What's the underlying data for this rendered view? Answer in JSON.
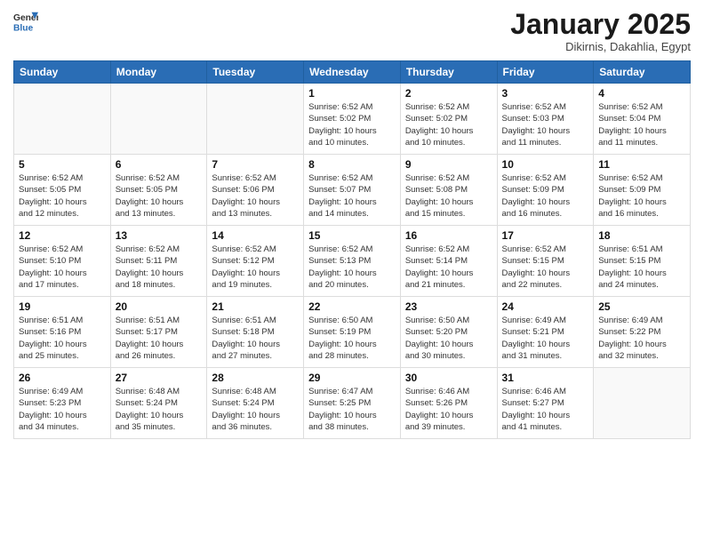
{
  "header": {
    "logo_general": "General",
    "logo_blue": "Blue",
    "title": "January 2025",
    "subtitle": "Dikirnis, Dakahlia, Egypt"
  },
  "days_of_week": [
    "Sunday",
    "Monday",
    "Tuesday",
    "Wednesday",
    "Thursday",
    "Friday",
    "Saturday"
  ],
  "weeks": [
    [
      {
        "day": "",
        "info": ""
      },
      {
        "day": "",
        "info": ""
      },
      {
        "day": "",
        "info": ""
      },
      {
        "day": "1",
        "info": "Sunrise: 6:52 AM\nSunset: 5:02 PM\nDaylight: 10 hours\nand 10 minutes."
      },
      {
        "day": "2",
        "info": "Sunrise: 6:52 AM\nSunset: 5:02 PM\nDaylight: 10 hours\nand 10 minutes."
      },
      {
        "day": "3",
        "info": "Sunrise: 6:52 AM\nSunset: 5:03 PM\nDaylight: 10 hours\nand 11 minutes."
      },
      {
        "day": "4",
        "info": "Sunrise: 6:52 AM\nSunset: 5:04 PM\nDaylight: 10 hours\nand 11 minutes."
      }
    ],
    [
      {
        "day": "5",
        "info": "Sunrise: 6:52 AM\nSunset: 5:05 PM\nDaylight: 10 hours\nand 12 minutes."
      },
      {
        "day": "6",
        "info": "Sunrise: 6:52 AM\nSunset: 5:05 PM\nDaylight: 10 hours\nand 13 minutes."
      },
      {
        "day": "7",
        "info": "Sunrise: 6:52 AM\nSunset: 5:06 PM\nDaylight: 10 hours\nand 13 minutes."
      },
      {
        "day": "8",
        "info": "Sunrise: 6:52 AM\nSunset: 5:07 PM\nDaylight: 10 hours\nand 14 minutes."
      },
      {
        "day": "9",
        "info": "Sunrise: 6:52 AM\nSunset: 5:08 PM\nDaylight: 10 hours\nand 15 minutes."
      },
      {
        "day": "10",
        "info": "Sunrise: 6:52 AM\nSunset: 5:09 PM\nDaylight: 10 hours\nand 16 minutes."
      },
      {
        "day": "11",
        "info": "Sunrise: 6:52 AM\nSunset: 5:09 PM\nDaylight: 10 hours\nand 16 minutes."
      }
    ],
    [
      {
        "day": "12",
        "info": "Sunrise: 6:52 AM\nSunset: 5:10 PM\nDaylight: 10 hours\nand 17 minutes."
      },
      {
        "day": "13",
        "info": "Sunrise: 6:52 AM\nSunset: 5:11 PM\nDaylight: 10 hours\nand 18 minutes."
      },
      {
        "day": "14",
        "info": "Sunrise: 6:52 AM\nSunset: 5:12 PM\nDaylight: 10 hours\nand 19 minutes."
      },
      {
        "day": "15",
        "info": "Sunrise: 6:52 AM\nSunset: 5:13 PM\nDaylight: 10 hours\nand 20 minutes."
      },
      {
        "day": "16",
        "info": "Sunrise: 6:52 AM\nSunset: 5:14 PM\nDaylight: 10 hours\nand 21 minutes."
      },
      {
        "day": "17",
        "info": "Sunrise: 6:52 AM\nSunset: 5:15 PM\nDaylight: 10 hours\nand 22 minutes."
      },
      {
        "day": "18",
        "info": "Sunrise: 6:51 AM\nSunset: 5:15 PM\nDaylight: 10 hours\nand 24 minutes."
      }
    ],
    [
      {
        "day": "19",
        "info": "Sunrise: 6:51 AM\nSunset: 5:16 PM\nDaylight: 10 hours\nand 25 minutes."
      },
      {
        "day": "20",
        "info": "Sunrise: 6:51 AM\nSunset: 5:17 PM\nDaylight: 10 hours\nand 26 minutes."
      },
      {
        "day": "21",
        "info": "Sunrise: 6:51 AM\nSunset: 5:18 PM\nDaylight: 10 hours\nand 27 minutes."
      },
      {
        "day": "22",
        "info": "Sunrise: 6:50 AM\nSunset: 5:19 PM\nDaylight: 10 hours\nand 28 minutes."
      },
      {
        "day": "23",
        "info": "Sunrise: 6:50 AM\nSunset: 5:20 PM\nDaylight: 10 hours\nand 30 minutes."
      },
      {
        "day": "24",
        "info": "Sunrise: 6:49 AM\nSunset: 5:21 PM\nDaylight: 10 hours\nand 31 minutes."
      },
      {
        "day": "25",
        "info": "Sunrise: 6:49 AM\nSunset: 5:22 PM\nDaylight: 10 hours\nand 32 minutes."
      }
    ],
    [
      {
        "day": "26",
        "info": "Sunrise: 6:49 AM\nSunset: 5:23 PM\nDaylight: 10 hours\nand 34 minutes."
      },
      {
        "day": "27",
        "info": "Sunrise: 6:48 AM\nSunset: 5:24 PM\nDaylight: 10 hours\nand 35 minutes."
      },
      {
        "day": "28",
        "info": "Sunrise: 6:48 AM\nSunset: 5:24 PM\nDaylight: 10 hours\nand 36 minutes."
      },
      {
        "day": "29",
        "info": "Sunrise: 6:47 AM\nSunset: 5:25 PM\nDaylight: 10 hours\nand 38 minutes."
      },
      {
        "day": "30",
        "info": "Sunrise: 6:46 AM\nSunset: 5:26 PM\nDaylight: 10 hours\nand 39 minutes."
      },
      {
        "day": "31",
        "info": "Sunrise: 6:46 AM\nSunset: 5:27 PM\nDaylight: 10 hours\nand 41 minutes."
      },
      {
        "day": "",
        "info": ""
      }
    ]
  ]
}
